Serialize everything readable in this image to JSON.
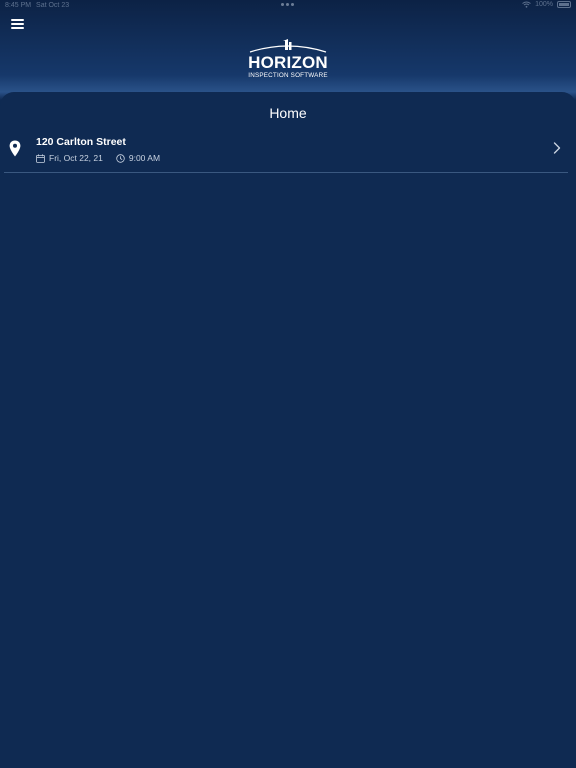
{
  "status_bar": {
    "time": "8:45 PM",
    "date": "Sat Oct 23",
    "battery": "100%",
    "icons": [
      "wifi-icon",
      "battery-icon"
    ]
  },
  "header": {
    "menu_icon": "hamburger-menu-icon",
    "logo_name": "HORIZON",
    "logo_tagline": "INSPECTION SOFTWARE"
  },
  "page": {
    "title": "Home"
  },
  "inspections": [
    {
      "address": "120 Carlton Street",
      "date": "Fri, Oct 22, 21",
      "time": "9:00 AM",
      "icons": [
        "location-pin-icon",
        "calendar-icon",
        "clock-icon",
        "chevron-right-icon"
      ]
    }
  ],
  "colors": {
    "background": "#0f2a52",
    "header_gradient_top": "#0c2245",
    "header_glow": "#2a5289",
    "text_primary": "#ffffff",
    "text_secondary": "#c9d3e1",
    "divider": "#3a5880"
  }
}
